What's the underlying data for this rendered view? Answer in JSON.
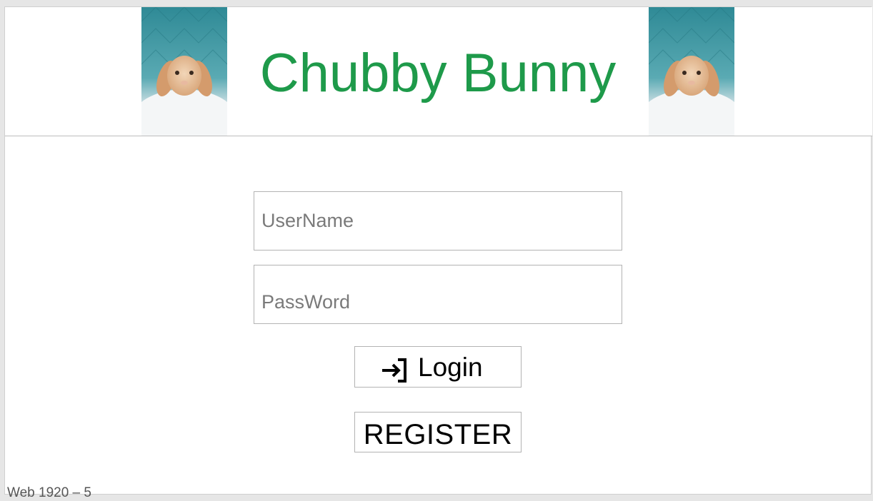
{
  "header": {
    "title": "Chubby Bunny",
    "title_color": "#1e9a4a",
    "images": [
      "bunny-photo",
      "bunny-photo"
    ]
  },
  "form": {
    "username": {
      "placeholder": "UserName",
      "value": ""
    },
    "password": {
      "placeholder": "PassWord",
      "value": ""
    },
    "login": {
      "label": "Login",
      "icon": "login-icon"
    },
    "register": {
      "label": "REGISTER"
    }
  },
  "frame_label": "Web 1920 – 5"
}
